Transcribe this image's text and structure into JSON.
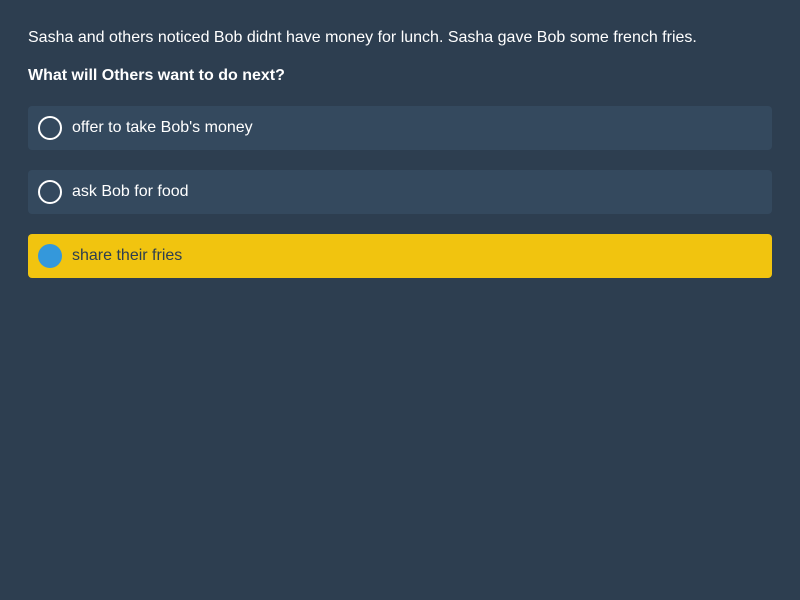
{
  "context": "Sasha and others noticed Bob didnt have money for lunch. Sasha gave Bob some french fries.",
  "question": "What will Others want to do next?",
  "options": [
    {
      "label": "offer to take Bob's money",
      "selected": false
    },
    {
      "label": "ask Bob for food",
      "selected": false
    },
    {
      "label": "share their fries",
      "selected": true
    }
  ],
  "colors": {
    "background": "#2d3e50",
    "option_bg": "#34495e",
    "selected_bg": "#f1c40f",
    "radio_checked": "#3498db"
  }
}
